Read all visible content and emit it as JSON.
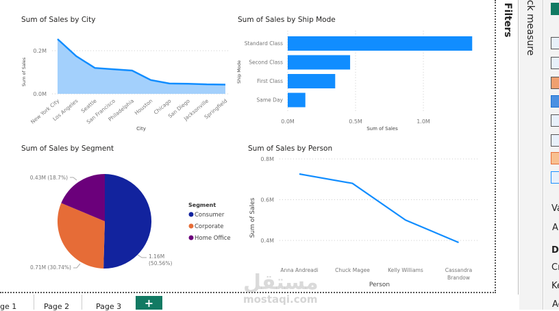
{
  "panes": {
    "filters": "Filters",
    "quick_measure": "ick measure",
    "viz_text": [
      "Va",
      "A",
      "Dr",
      "Cr",
      "Ke",
      "Ac"
    ]
  },
  "pages": {
    "tabs": [
      "ge 1",
      "Page 2",
      "Page 3"
    ],
    "add": "+"
  },
  "watermark": {
    "arabic": "مستقل",
    "latin": "mostaqi.com"
  },
  "colors": {
    "accent": "#118dff",
    "area_fill": "#a3d0fc",
    "consumer": "#12239e",
    "corporate": "#e66c37",
    "home_office": "#6b007b"
  },
  "chart_data": [
    {
      "type": "area",
      "title": "Sum of Sales by City",
      "xlabel": "City",
      "ylabel": "Sum of Sales",
      "categories": [
        "New York City",
        "Los Angeles",
        "Seattle",
        "San Francisco",
        "Philadelphia",
        "Houston",
        "Chicago",
        "San Diego",
        "Jacksonville",
        "Springfield"
      ],
      "values": [
        0.254,
        0.175,
        0.12,
        0.114,
        0.108,
        0.064,
        0.048,
        0.047,
        0.044,
        0.043
      ],
      "yticks": [
        "0.0M",
        "0.2M"
      ],
      "ylim": [
        0,
        0.27
      ]
    },
    {
      "type": "bar",
      "title": "Sum of Sales by Ship Mode",
      "xlabel": "Sum of Sales",
      "ylabel": "Ship Mode",
      "categories": [
        "Standard Class",
        "Second Class",
        "First Class",
        "Same Day"
      ],
      "values": [
        1.36,
        0.46,
        0.35,
        0.13
      ],
      "xticks": [
        "0.0M",
        "0.5M",
        "1.0M"
      ],
      "xlim": [
        0,
        1.36
      ]
    },
    {
      "type": "pie",
      "title": "Sum of Sales by Segment",
      "legend_title": "Segment",
      "categories": [
        "Consumer",
        "Corporate",
        "Home Office"
      ],
      "values": [
        1.16,
        0.71,
        0.43
      ],
      "percents": [
        50.56,
        30.74,
        18.7
      ],
      "labels": [
        "1.16M",
        "(50.56%)",
        "0.71M (30.74%)",
        "0.43M (18.7%)"
      ],
      "legend": "right"
    },
    {
      "type": "line",
      "title": "Sum of Sales by Person",
      "xlabel": "Person",
      "ylabel": "Sum of Sales",
      "categories": [
        "Anna Andreadi",
        "Chuck Magee",
        "Kelly Williams",
        "Cassandra Brandow"
      ],
      "values": [
        0.726,
        0.68,
        0.5,
        0.39
      ],
      "yticks": [
        "0.4M",
        "0.6M",
        "0.8M"
      ],
      "ylim": [
        0.4,
        0.8
      ]
    }
  ]
}
